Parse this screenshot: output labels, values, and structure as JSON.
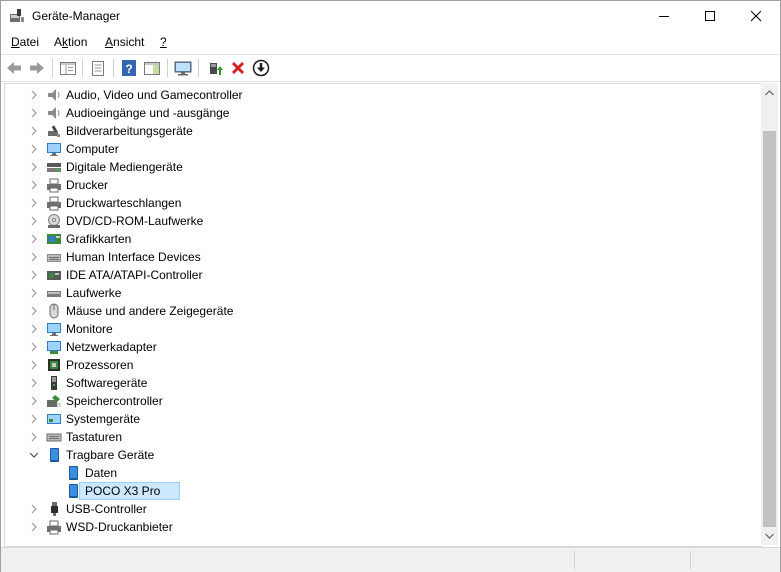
{
  "window": {
    "title": "Geräte-Manager",
    "icon": "device-manager-icon",
    "controls": [
      "minimize-icon",
      "maximize-icon",
      "close-icon"
    ]
  },
  "menu": {
    "items": [
      "Datei",
      "Aktion",
      "Ansicht",
      "?"
    ],
    "mnemonics": [
      "D",
      "k",
      "A",
      "?"
    ]
  },
  "toolbar": {
    "buttons": [
      "back-icon",
      "forward-icon",
      "show-hide-console-tree-icon",
      "properties-icon",
      "help-icon",
      "action-pane-icon",
      "scan-hardware-icon",
      "update-driver-icon",
      "uninstall-device-icon",
      "download-icon"
    ]
  },
  "tree": {
    "nodes": [
      {
        "label": "Audio, Video und Gamecontroller",
        "icon": "speaker-icon",
        "expanded": false,
        "level": 0
      },
      {
        "label": "Audioeingänge und -ausgänge",
        "icon": "speaker-icon",
        "expanded": false,
        "level": 0
      },
      {
        "label": "Bildverarbeitungsgeräte",
        "icon": "camera-icon",
        "expanded": false,
        "level": 0
      },
      {
        "label": "Computer",
        "icon": "monitor-icon",
        "expanded": false,
        "level": 0
      },
      {
        "label": "Digitale Mediengeräte",
        "icon": "media-device-icon",
        "expanded": false,
        "level": 0
      },
      {
        "label": "Drucker",
        "icon": "printer-icon",
        "expanded": false,
        "level": 0
      },
      {
        "label": "Druckwarteschlangen",
        "icon": "printer-icon",
        "expanded": false,
        "level": 0
      },
      {
        "label": "DVD/CD-ROM-Laufwerke",
        "icon": "disc-drive-icon",
        "expanded": false,
        "level": 0
      },
      {
        "label": "Grafikkarten",
        "icon": "display-adapter-icon",
        "expanded": false,
        "level": 0
      },
      {
        "label": "Human Interface Devices",
        "icon": "hid-icon",
        "expanded": false,
        "level": 0
      },
      {
        "label": "IDE ATA/ATAPI-Controller",
        "icon": "ide-controller-icon",
        "expanded": false,
        "level": 0
      },
      {
        "label": "Laufwerke",
        "icon": "disk-drive-icon",
        "expanded": false,
        "level": 0
      },
      {
        "label": "Mäuse und andere Zeigegeräte",
        "icon": "mouse-icon",
        "expanded": false,
        "level": 0
      },
      {
        "label": "Monitore",
        "icon": "monitor-icon",
        "expanded": false,
        "level": 0
      },
      {
        "label": "Netzwerkadapter",
        "icon": "network-adapter-icon",
        "expanded": false,
        "level": 0
      },
      {
        "label": "Prozessoren",
        "icon": "processor-icon",
        "expanded": false,
        "level": 0
      },
      {
        "label": "Softwaregeräte",
        "icon": "software-device-icon",
        "expanded": false,
        "level": 0
      },
      {
        "label": "Speichercontroller",
        "icon": "storage-controller-icon",
        "expanded": false,
        "level": 0
      },
      {
        "label": "Systemgeräte",
        "icon": "system-device-icon",
        "expanded": false,
        "level": 0
      },
      {
        "label": "Tastaturen",
        "icon": "keyboard-icon",
        "expanded": false,
        "level": 0
      },
      {
        "label": "Tragbare Geräte",
        "icon": "portable-device-icon",
        "expanded": true,
        "level": 0
      },
      {
        "label": "Daten",
        "icon": "portable-device-icon",
        "expanded": null,
        "level": 1
      },
      {
        "label": "POCO X3 Pro",
        "icon": "portable-device-icon",
        "expanded": null,
        "level": 1,
        "selected": true
      },
      {
        "label": "USB-Controller",
        "icon": "usb-icon",
        "expanded": false,
        "level": 0
      },
      {
        "label": "WSD-Druckanbieter",
        "icon": "printer-icon",
        "expanded": false,
        "level": 0
      }
    ]
  },
  "colors": {
    "selection_bg": "#cce8ff",
    "selection_border": "#99d1ff"
  }
}
